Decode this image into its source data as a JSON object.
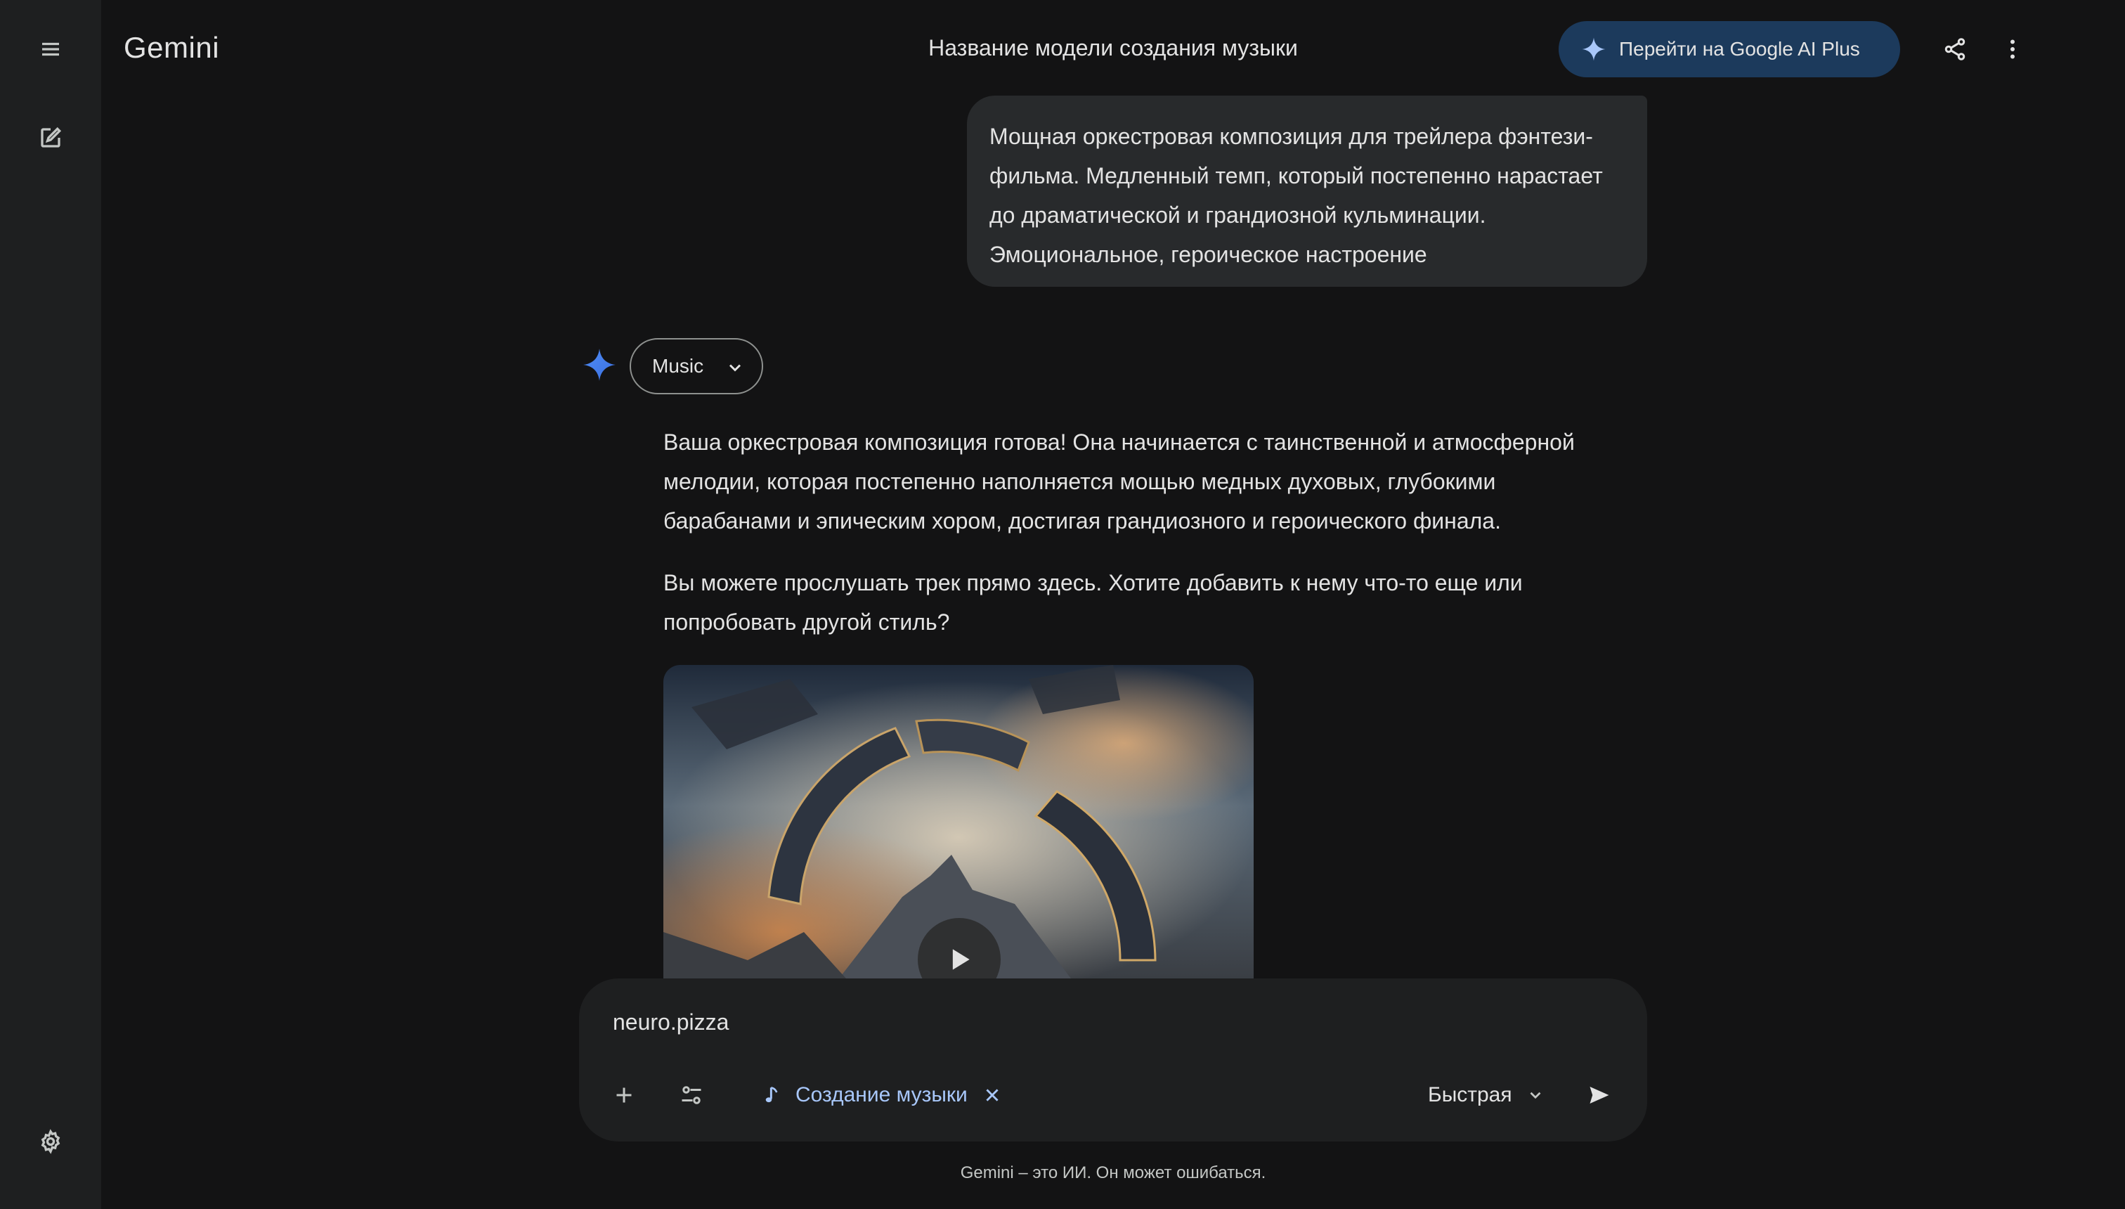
{
  "app": {
    "logo": "Gemini"
  },
  "header": {
    "title": "Название модели создания музыки",
    "upgrade_label": "Перейти на Google AI Plus"
  },
  "sidebar": {
    "menu_icon": "menu-icon",
    "new_chat_icon": "edit-icon",
    "settings_icon": "gear-icon"
  },
  "conversation": {
    "user_message": "Мощная оркестровая композиция для трейлера фэнтези-фильма. Медленный темп, который постепенно нарастает до драматической и грандиозной кульминации. Эмоциональное, героическое настроение",
    "model_chip": "Music",
    "response_paragraphs": [
      "Ваша оркестровая композиция готова! Она начинается с таинственной и атмосферной мелодии, которая постепенно наполняется мощью медных духовых, глубокими барабанами и эпическим хором, достигая грандиозного и героического финала.",
      "Вы можете прослушать трек прямо здесь. Хотите добавить к нему что-то еще или попробовать другой стиль?"
    ]
  },
  "composer": {
    "value": "neuro.pizza",
    "tool_label": "Создание музыки",
    "mode_label": "Быстрая"
  },
  "footer": {
    "disclaimer": "Gemini – это ИИ. Он может ошибаться."
  },
  "colors": {
    "background": "#131314",
    "sidebar": "#1e1f20",
    "accent_blue": "#a8c7fa",
    "upgrade_button": "#1c3a5c"
  }
}
